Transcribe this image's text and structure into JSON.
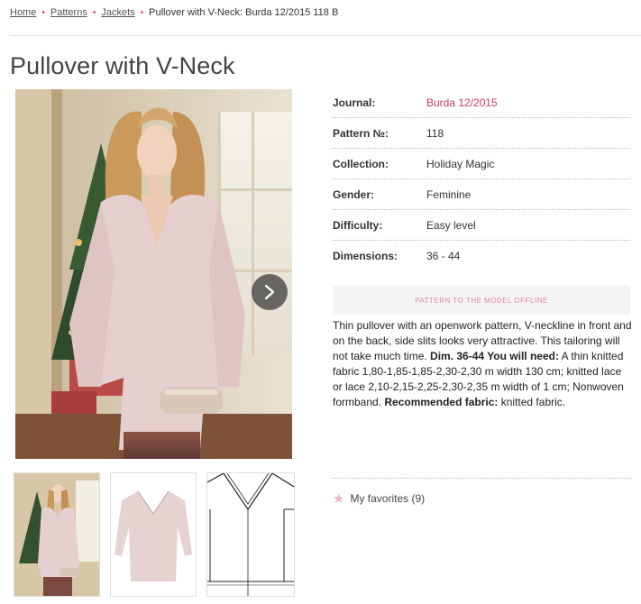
{
  "breadcrumb": {
    "items": [
      "Home",
      "Patterns",
      "Jackets"
    ],
    "current": "Pullover with V-Neck: Burda 12/2015 118 B"
  },
  "title": "Pullover with V-Neck",
  "details": [
    {
      "label": "Journal:",
      "value": "Burda 12/2015",
      "link": true
    },
    {
      "label": "Pattern №:",
      "value": "118",
      "link": false
    },
    {
      "label": "Collection:",
      "value": "Holiday Magic",
      "link": false
    },
    {
      "label": "Gender:",
      "value": "Feminine",
      "link": false
    },
    {
      "label": "Difficulty:",
      "value": "Easy level",
      "link": false
    },
    {
      "label": "Dimensions:",
      "value": "36 - 44",
      "link": false
    }
  ],
  "offline_button": "PATTERN TO THE MODEL OFFLINE",
  "description": {
    "part1": "Thin pullover with an openwork pattern, V-neckline in front and on the back, side slits looks very attractive. This tailoring will not take much time. ",
    "bold1": "Dim. 36-44 You will need:",
    "part2": " A thin knitted fabric 1,80-1,85-1,85-2,30-2,30 m width 130 cm; knitted lace or lace 2,10-2,15-2,25-2,30-2,35 m width of 1 cm; Nonwoven formband. ",
    "bold2": "Recommended fabric:",
    "part3": " knitted fabric."
  },
  "favorites": {
    "label": "My favorites (9)"
  },
  "colors": {
    "accent": "#d0365f",
    "button_bg": "#f4f4f4",
    "sweater": "#e6cfcf"
  },
  "icons": {
    "next": "chevron-right-icon",
    "favorite": "star-icon"
  }
}
